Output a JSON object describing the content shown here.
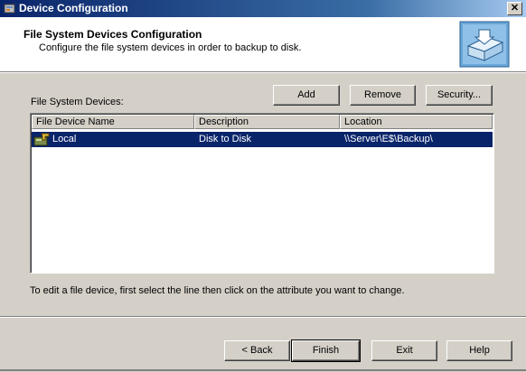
{
  "window": {
    "title": "Device Configuration",
    "close_label": "✕"
  },
  "header": {
    "title": "File System Devices Configuration",
    "subtitle": "Configure the file system devices in order to backup to disk."
  },
  "devices": {
    "label": "File System Devices:",
    "add_label": "Add",
    "remove_label": "Remove",
    "security_label": "Security...",
    "columns": [
      "File Device Name",
      "Description",
      "Location"
    ],
    "rows": [
      {
        "name": "Local",
        "description": "Disk to Disk",
        "location": "\\\\Server\\E$\\Backup\\",
        "selected": true
      }
    ]
  },
  "hint": "To edit a file device, first select the line then click on the attribute you want to change.",
  "footer": {
    "back_label": "< Back",
    "finish_label": "Finish",
    "exit_label": "Exit",
    "help_label": "Help"
  },
  "colors": {
    "title_bar": "#0a246a",
    "selection": "#0a246a",
    "face": "#d4d0c8"
  },
  "icons": {
    "app": "app-icon",
    "header": "backup-drive-icon",
    "row": "file-device-icon"
  }
}
